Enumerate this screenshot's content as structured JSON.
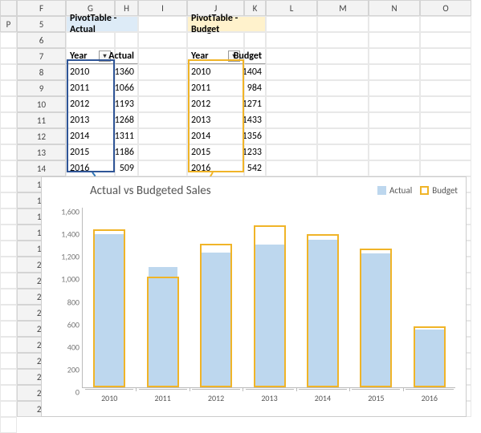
{
  "columns": [
    "F",
    "G",
    "H",
    "I",
    "J",
    "K",
    "L",
    "M",
    "N",
    "O",
    "P"
  ],
  "rows_start": 5,
  "rows_end": 29,
  "titles": {
    "actual": "PivotTable - Actual",
    "budget": "PivotTable - Budget"
  },
  "headers": {
    "year1": "Year",
    "actual": "Actual",
    "year2": "Year",
    "budget": "Budget"
  },
  "table": {
    "years": [
      "2010",
      "2011",
      "2012",
      "2013",
      "2014",
      "2015",
      "2016"
    ],
    "actual": [
      1360,
      1066,
      1193,
      1268,
      1311,
      1186,
      509
    ],
    "budget": [
      1404,
      984,
      1271,
      1433,
      1356,
      1233,
      542
    ]
  },
  "chart": {
    "title": "Actual vs Budgeted Sales",
    "legend": {
      "s1": "Actual",
      "s2": "Budget"
    }
  },
  "chart_data": {
    "type": "bar",
    "categories": [
      "2010",
      "2011",
      "2012",
      "2013",
      "2014",
      "2015",
      "2016"
    ],
    "series": [
      {
        "name": "Actual",
        "values": [
          1360,
          1066,
          1193,
          1268,
          1311,
          1186,
          509
        ]
      },
      {
        "name": "Budget",
        "values": [
          1404,
          984,
          1271,
          1433,
          1356,
          1233,
          542
        ]
      }
    ],
    "title": "Actual vs Budgeted Sales",
    "xlabel": "",
    "ylabel": "",
    "ylim": [
      0,
      1600
    ],
    "yticks": [
      0,
      200,
      400,
      600,
      800,
      1000,
      1200,
      1400,
      1600
    ]
  }
}
